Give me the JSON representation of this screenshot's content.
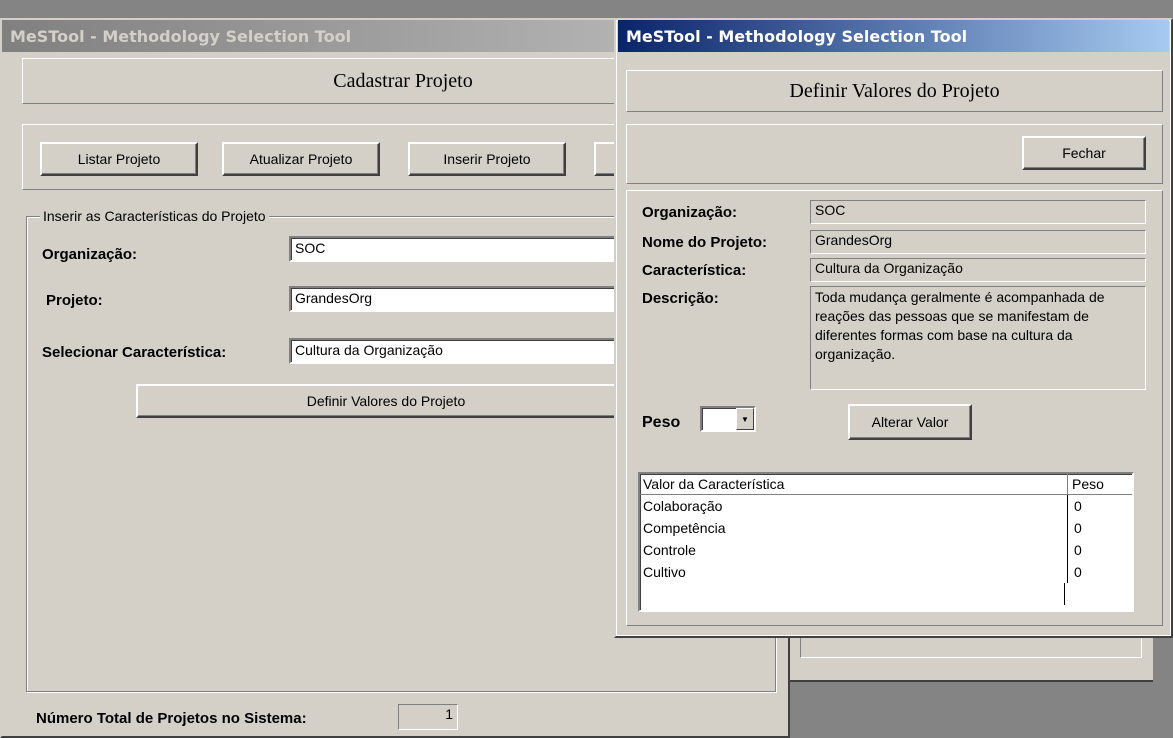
{
  "back_window": {
    "title": "MeSTool - Methodology Selection Tool",
    "header": "Cadastrar Projeto",
    "toolbar": {
      "listar": "Listar Projeto",
      "atualizar": "Atualizar Projeto",
      "inserir": "Inserir Projeto"
    },
    "group_title": "Inserir as Características do Projeto",
    "organizacao_label": "Organização:",
    "organizacao_value": "SOC",
    "projeto_label": "Projeto:",
    "projeto_value": "GrandesOrg",
    "caracteristica_label": "Selecionar Característica:",
    "caracteristica_value": "Cultura da Organização",
    "definir_button": "Definir Valores do Projeto",
    "total_label": "Número Total de Projetos no Sistema:",
    "total_value": "1"
  },
  "front_window": {
    "title": "MeSTool - Methodology Selection Tool",
    "header": "Definir Valores do Projeto",
    "fechar_button": "Fechar",
    "fields": {
      "organizacao_label": "Organização:",
      "organizacao_value": "SOC",
      "nome_label": "Nome do Projeto:",
      "nome_value": "GrandesOrg",
      "caracteristica_label": "Característica:",
      "caracteristica_value": "Cultura da Organização",
      "descricao_label": "Descrição:",
      "descricao_value": "Toda mudança geralmente é acompanhada de reações das pessoas que se manifestam de diferentes formas com base na cultura da organização."
    },
    "peso_label": "Peso",
    "peso_value": "",
    "alterar_button": "Alterar Valor",
    "table": {
      "columns": [
        "Valor da Característica",
        "Peso"
      ],
      "rows": [
        [
          "Colaboração",
          "0"
        ],
        [
          "Competência",
          "0"
        ],
        [
          "Controle",
          "0"
        ],
        [
          "Cultivo",
          "0"
        ]
      ]
    }
  }
}
